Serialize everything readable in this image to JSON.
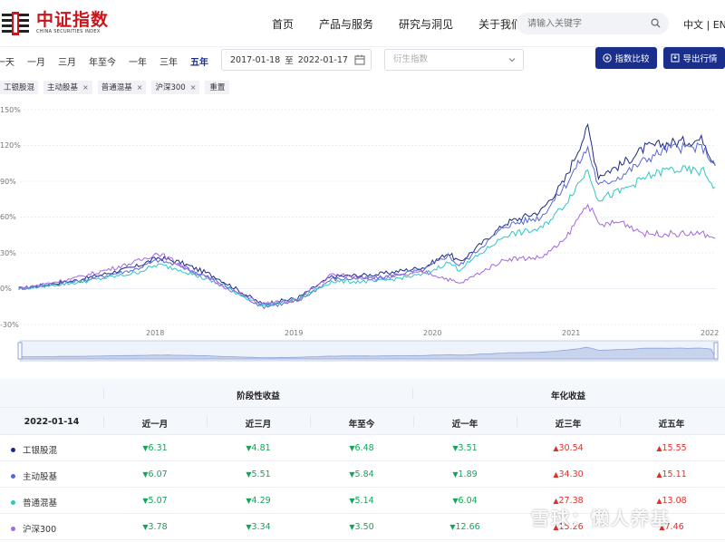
{
  "header": {
    "logo_cn": "中证指数",
    "logo_en": "CHINA SECURITIES INDEX",
    "nav": [
      "首页",
      "产品与服务",
      "研究与洞见",
      "关于我们"
    ],
    "search_placeholder": "请输入关键字",
    "lang_cn": "中文",
    "lang_sep": "|",
    "lang_en": "EN"
  },
  "toolbar": {
    "ranges": [
      "一天",
      "一月",
      "三月",
      "年至今",
      "一年",
      "三年",
      "五年"
    ],
    "active_range": "五年",
    "date_from": "2017-01-18",
    "date_sep": "至",
    "date_to": "2022-01-17",
    "derivative_placeholder": "衍生指数",
    "compare_label": "指数比较",
    "export_label": "导出行情"
  },
  "tags": {
    "items": [
      "工银股混",
      "主动股基",
      "普通混基",
      "沪深300"
    ],
    "reset_label": "重置"
  },
  "chart_data": {
    "type": "line",
    "y_ticks": [
      "150%",
      "120%",
      "90%",
      "60%",
      "30%",
      "0%",
      "-30%"
    ],
    "x_ticks": [
      "2018",
      "2019",
      "2020",
      "2021",
      "2022"
    ],
    "ylim": [
      -30,
      150
    ],
    "xlim": [
      "2017-01-18",
      "2022-01-17"
    ],
    "grid": true,
    "series": [
      {
        "name": "工银股混",
        "color": "#1e2a84",
        "points": [
          [
            "2017-01",
            0
          ],
          [
            "2017-06",
            7
          ],
          [
            "2017-11",
            18
          ],
          [
            "2018-01",
            26
          ],
          [
            "2018-03",
            22
          ],
          [
            "2018-06",
            10
          ],
          [
            "2018-10",
            -13
          ],
          [
            "2019-01",
            -8
          ],
          [
            "2019-04",
            10
          ],
          [
            "2019-08",
            12
          ],
          [
            "2019-12",
            18
          ],
          [
            "2020-02",
            30
          ],
          [
            "2020-03",
            22
          ],
          [
            "2020-07",
            55
          ],
          [
            "2020-10",
            65
          ],
          [
            "2020-12",
            90
          ],
          [
            "2021-02",
            135
          ],
          [
            "2021-03",
            95
          ],
          [
            "2021-05",
            104
          ],
          [
            "2021-07",
            118
          ],
          [
            "2021-09",
            122
          ],
          [
            "2021-12",
            125
          ],
          [
            "2022-01",
            104
          ]
        ]
      },
      {
        "name": "主动股基",
        "color": "#5868d6",
        "points": [
          [
            "2017-01",
            0
          ],
          [
            "2017-06",
            6
          ],
          [
            "2017-11",
            16
          ],
          [
            "2018-01",
            24
          ],
          [
            "2018-03",
            19
          ],
          [
            "2018-06",
            7
          ],
          [
            "2018-10",
            -15
          ],
          [
            "2019-01",
            -11
          ],
          [
            "2019-04",
            8
          ],
          [
            "2019-08",
            9
          ],
          [
            "2019-12",
            16
          ],
          [
            "2020-02",
            28
          ],
          [
            "2020-03",
            19
          ],
          [
            "2020-07",
            53
          ],
          [
            "2020-10",
            60
          ],
          [
            "2020-12",
            85
          ],
          [
            "2021-02",
            118
          ],
          [
            "2021-03",
            86
          ],
          [
            "2021-05",
            95
          ],
          [
            "2021-07",
            108
          ],
          [
            "2021-09",
            118
          ],
          [
            "2021-12",
            118
          ],
          [
            "2022-01",
            103
          ]
        ]
      },
      {
        "name": "普通混基",
        "color": "#2fc7c1",
        "points": [
          [
            "2017-01",
            0
          ],
          [
            "2017-06",
            5
          ],
          [
            "2017-11",
            13
          ],
          [
            "2018-01",
            20
          ],
          [
            "2018-03",
            16
          ],
          [
            "2018-06",
            5
          ],
          [
            "2018-10",
            -14
          ],
          [
            "2019-01",
            -9
          ],
          [
            "2019-04",
            6
          ],
          [
            "2019-08",
            6
          ],
          [
            "2019-12",
            12
          ],
          [
            "2020-02",
            22
          ],
          [
            "2020-03",
            16
          ],
          [
            "2020-07",
            45
          ],
          [
            "2020-10",
            50
          ],
          [
            "2020-12",
            70
          ],
          [
            "2021-02",
            100
          ],
          [
            "2021-03",
            75
          ],
          [
            "2021-05",
            82
          ],
          [
            "2021-07",
            93
          ],
          [
            "2021-09",
            100
          ],
          [
            "2021-12",
            98
          ],
          [
            "2022-01",
            85
          ]
        ]
      },
      {
        "name": "沪深300",
        "color": "#a567e0",
        "points": [
          [
            "2017-01",
            0
          ],
          [
            "2017-06",
            9
          ],
          [
            "2017-11",
            22
          ],
          [
            "2018-01",
            30
          ],
          [
            "2018-03",
            20
          ],
          [
            "2018-06",
            5
          ],
          [
            "2018-10",
            -13
          ],
          [
            "2019-01",
            -10
          ],
          [
            "2019-04",
            12
          ],
          [
            "2019-08",
            8
          ],
          [
            "2019-12",
            14
          ],
          [
            "2020-02",
            8
          ],
          [
            "2020-03",
            4
          ],
          [
            "2020-07",
            25
          ],
          [
            "2020-10",
            26
          ],
          [
            "2020-12",
            40
          ],
          [
            "2021-02",
            72
          ],
          [
            "2021-03",
            53
          ],
          [
            "2021-05",
            56
          ],
          [
            "2021-07",
            46
          ],
          [
            "2021-09",
            46
          ],
          [
            "2021-12",
            46
          ],
          [
            "2022-01",
            42
          ]
        ]
      }
    ]
  },
  "table": {
    "group_period": "阶段性收益",
    "group_annual": "年化收益",
    "date": "2022-01-14",
    "columns": [
      "近一月",
      "近三月",
      "年至今",
      "近一年",
      "近三年",
      "近五年"
    ],
    "rows": [
      {
        "name": "工银股混",
        "color": "#1e2a84",
        "values": [
          {
            "dir": "down",
            "text": "6.31"
          },
          {
            "dir": "down",
            "text": "4.81"
          },
          {
            "dir": "down",
            "text": "6.48"
          },
          {
            "dir": "down",
            "text": "3.51"
          },
          {
            "dir": "up",
            "text": "30.54"
          },
          {
            "dir": "up",
            "text": "15.55"
          }
        ]
      },
      {
        "name": "主动股基",
        "color": "#5868d6",
        "values": [
          {
            "dir": "down",
            "text": "6.07"
          },
          {
            "dir": "down",
            "text": "5.51"
          },
          {
            "dir": "down",
            "text": "5.84"
          },
          {
            "dir": "down",
            "text": "1.89"
          },
          {
            "dir": "up",
            "text": "34.30"
          },
          {
            "dir": "up",
            "text": "15.11"
          }
        ]
      },
      {
        "name": "普通混基",
        "color": "#2fc7c1",
        "values": [
          {
            "dir": "down",
            "text": "5.07"
          },
          {
            "dir": "down",
            "text": "4.29"
          },
          {
            "dir": "down",
            "text": "5.14"
          },
          {
            "dir": "down",
            "text": "6.04"
          },
          {
            "dir": "up",
            "text": "27.38"
          },
          {
            "dir": "up",
            "text": "13.08"
          }
        ]
      },
      {
        "name": "沪深300",
        "color": "#a567e0",
        "values": [
          {
            "dir": "down",
            "text": "3.78"
          },
          {
            "dir": "down",
            "text": "3.34"
          },
          {
            "dir": "down",
            "text": "3.50"
          },
          {
            "dir": "down",
            "text": "12.66"
          },
          {
            "dir": "up",
            "text": "15.26"
          },
          {
            "dir": "up",
            "text": "7.46"
          }
        ]
      }
    ]
  },
  "watermark": "雪球：懒人养基"
}
